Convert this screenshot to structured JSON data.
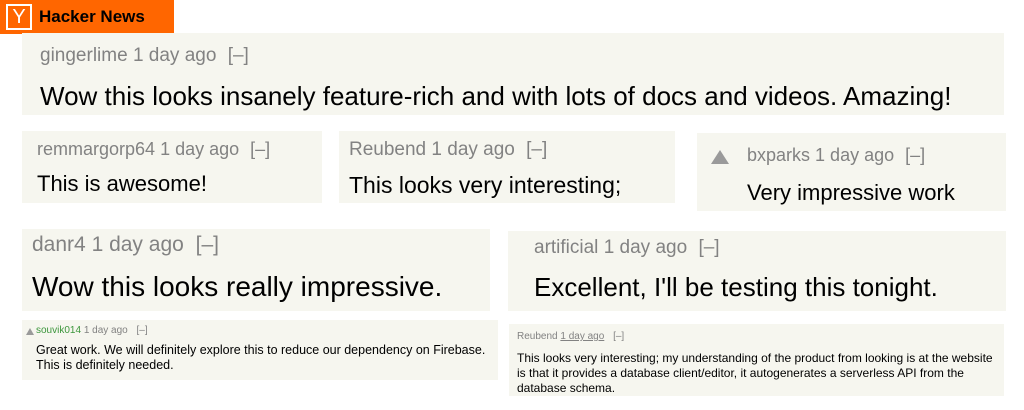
{
  "header": {
    "logo_letter": "Y",
    "title": "Hacker News"
  },
  "comments": [
    {
      "user": "gingerlime",
      "age": "1 day ago",
      "toggle": "[–]",
      "text": "Wow this looks insanely feature-rich and with lots of docs and videos. Amazing!"
    },
    {
      "user": "remmargorp64",
      "age": "1 day ago",
      "toggle": "[–]",
      "text": "This is awesome!"
    },
    {
      "user": "Reubend",
      "age": "1 day ago",
      "toggle": "[–]",
      "text": "This looks very interesting;"
    },
    {
      "user": "bxparks",
      "age": "1 day ago",
      "toggle": "[–]",
      "text": "Very impressive work"
    },
    {
      "user": "danr4",
      "age": "1 day ago",
      "toggle": "[–]",
      "text": "Wow this looks really impressive."
    },
    {
      "user": "artificial",
      "age": "1 day ago",
      "toggle": "[–]",
      "text": "Excellent, I'll be testing this tonight."
    },
    {
      "user": "souvik014",
      "age": "1 day ago",
      "toggle": "[–]",
      "text": "Great work. We will definitely explore this to reduce our dependency on Firebase. This is definitely needed."
    },
    {
      "user": "Reubend",
      "age": "1 day ago",
      "toggle": "[–]",
      "text": "This looks very interesting; my understanding of the product from looking is at the website is that it provides a database client/editor, it autogenerates a serverless API from the database schema."
    }
  ]
}
